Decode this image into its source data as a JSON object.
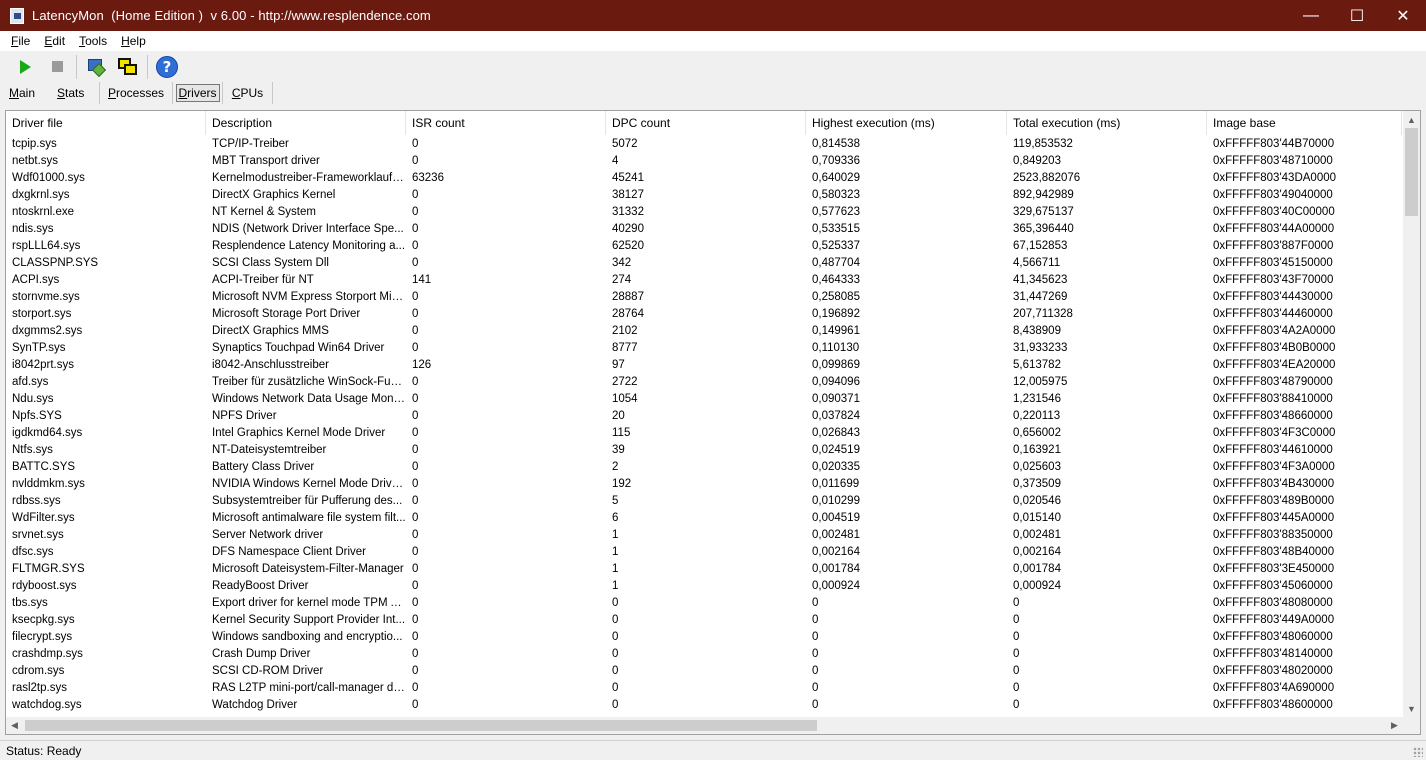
{
  "window": {
    "title": "LatencyMon  (Home Edition )  v 6.00 - http://www.resplendence.com",
    "minimize_glyph": "—",
    "maximize_glyph": "☐",
    "close_glyph": "✕"
  },
  "menu": [
    "File",
    "Edit",
    "Tools",
    "Help"
  ],
  "toolbar": {
    "buttons": [
      {
        "name": "start-icon"
      },
      {
        "name": "stop-icon"
      },
      {
        "name": "tool-icon"
      },
      {
        "name": "windows-icon"
      },
      {
        "name": "help-icon",
        "glyph": "?"
      }
    ]
  },
  "tabs": {
    "main": "Main",
    "stats": "Stats",
    "processes": "Processes",
    "drivers": "Drivers",
    "cpus": "CPUs",
    "selected": "Drivers"
  },
  "table": {
    "columns": [
      "Driver file",
      "Description",
      "ISR count",
      "DPC count",
      "Highest execution (ms)",
      "Total execution (ms)",
      "Image base"
    ],
    "rows": [
      [
        "tcpip.sys",
        "TCP/IP-Treiber",
        "0",
        "5072",
        "0,814538",
        "119,853532",
        "0xFFFFF803'44B70000"
      ],
      [
        "netbt.sys",
        "MBT Transport driver",
        "0",
        "4",
        "0,709336",
        "0,849203",
        "0xFFFFF803'48710000"
      ],
      [
        "Wdf01000.sys",
        "Kernelmodustreiber-Frameworklaufzeit",
        "63236",
        "45241",
        "0,640029",
        "2523,882076",
        "0xFFFFF803'43DA0000"
      ],
      [
        "dxgkrnl.sys",
        "DirectX Graphics Kernel",
        "0",
        "38127",
        "0,580323",
        "892,942989",
        "0xFFFFF803'49040000"
      ],
      [
        "ntoskrnl.exe",
        "NT Kernel & System",
        "0",
        "31332",
        "0,577623",
        "329,675137",
        "0xFFFFF803'40C00000"
      ],
      [
        "ndis.sys",
        "NDIS (Network Driver Interface Spe...",
        "0",
        "40290",
        "0,533515",
        "365,396440",
        "0xFFFFF803'44A00000"
      ],
      [
        "rspLLL64.sys",
        "Resplendence Latency Monitoring a...",
        "0",
        "62520",
        "0,525337",
        "67,152853",
        "0xFFFFF803'887F0000"
      ],
      [
        "CLASSPNP.SYS",
        "SCSI Class System Dll",
        "0",
        "342",
        "0,487704",
        "4,566711",
        "0xFFFFF803'45150000"
      ],
      [
        "ACPI.sys",
        "ACPI-Treiber für NT",
        "141",
        "274",
        "0,464333",
        "41,345623",
        "0xFFFFF803'43F70000"
      ],
      [
        "stornvme.sys",
        "Microsoft NVM Express Storport Mini...",
        "0",
        "28887",
        "0,258085",
        "31,447269",
        "0xFFFFF803'44430000"
      ],
      [
        "storport.sys",
        "Microsoft Storage Port Driver",
        "0",
        "28764",
        "0,196892",
        "207,711328",
        "0xFFFFF803'44460000"
      ],
      [
        "dxgmms2.sys",
        "DirectX Graphics MMS",
        "0",
        "2102",
        "0,149961",
        "8,438909",
        "0xFFFFF803'4A2A0000"
      ],
      [
        "SynTP.sys",
        "Synaptics Touchpad Win64 Driver",
        "0",
        "8777",
        "0,110130",
        "31,933233",
        "0xFFFFF803'4B0B0000"
      ],
      [
        "i8042prt.sys",
        "i8042-Anschlusstreiber",
        "126",
        "97",
        "0,099869",
        "5,613782",
        "0xFFFFF803'4EA20000"
      ],
      [
        "afd.sys",
        "Treiber für zusätzliche WinSock-Fun...",
        "0",
        "2722",
        "0,094096",
        "12,005975",
        "0xFFFFF803'48790000"
      ],
      [
        "Ndu.sys",
        "Windows Network Data Usage Monit...",
        "0",
        "1054",
        "0,090371",
        "1,231546",
        "0xFFFFF803'88410000"
      ],
      [
        "Npfs.SYS",
        "NPFS Driver",
        "0",
        "20",
        "0,037824",
        "0,220113",
        "0xFFFFF803'48660000"
      ],
      [
        "igdkmd64.sys",
        "Intel Graphics Kernel Mode Driver",
        "0",
        "115",
        "0,026843",
        "0,656002",
        "0xFFFFF803'4F3C0000"
      ],
      [
        "Ntfs.sys",
        "NT-Dateisystemtreiber",
        "0",
        "39",
        "0,024519",
        "0,163921",
        "0xFFFFF803'44610000"
      ],
      [
        "BATTC.SYS",
        "Battery Class Driver",
        "0",
        "2",
        "0,020335",
        "0,025603",
        "0xFFFFF803'4F3A0000"
      ],
      [
        "nvlddmkm.sys",
        "NVIDIA Windows Kernel Mode Drive...",
        "0",
        "192",
        "0,011699",
        "0,373509",
        "0xFFFFF803'4B430000"
      ],
      [
        "rdbss.sys",
        "Subsystemtreiber für Pufferung des...",
        "0",
        "5",
        "0,010299",
        "0,020546",
        "0xFFFFF803'489B0000"
      ],
      [
        "WdFilter.sys",
        "Microsoft antimalware file system filt...",
        "0",
        "6",
        "0,004519",
        "0,015140",
        "0xFFFFF803'445A0000"
      ],
      [
        "srvnet.sys",
        "Server Network driver",
        "0",
        "1",
        "0,002481",
        "0,002481",
        "0xFFFFF803'88350000"
      ],
      [
        "dfsc.sys",
        "DFS Namespace Client Driver",
        "0",
        "1",
        "0,002164",
        "0,002164",
        "0xFFFFF803'48B40000"
      ],
      [
        "FLTMGR.SYS",
        "Microsoft Dateisystem-Filter-Manager",
        "0",
        "1",
        "0,001784",
        "0,001784",
        "0xFFFFF803'3E450000"
      ],
      [
        "rdyboost.sys",
        "ReadyBoost Driver",
        "0",
        "1",
        "0,000924",
        "0,000924",
        "0xFFFFF803'45060000"
      ],
      [
        "tbs.sys",
        "Export driver for kernel mode TPM API",
        "0",
        "0",
        "0",
        "0",
        "0xFFFFF803'48080000"
      ],
      [
        "ksecpkg.sys",
        "Kernel Security Support Provider Int...",
        "0",
        "0",
        "0",
        "0",
        "0xFFFFF803'449A0000"
      ],
      [
        "filecrypt.sys",
        "Windows sandboxing and encryptio...",
        "0",
        "0",
        "0",
        "0",
        "0xFFFFF803'48060000"
      ],
      [
        "crashdmp.sys",
        "Crash Dump Driver",
        "0",
        "0",
        "0",
        "0",
        "0xFFFFF803'48140000"
      ],
      [
        "cdrom.sys",
        "SCSI CD-ROM Driver",
        "0",
        "0",
        "0",
        "0",
        "0xFFFFF803'48020000"
      ],
      [
        "rasl2tp.sys",
        "RAS L2TP mini-port/call-manager dri...",
        "0",
        "0",
        "0",
        "0",
        "0xFFFFF803'4A690000"
      ],
      [
        "watchdog.sys",
        "Watchdog Driver",
        "0",
        "0",
        "0",
        "0",
        "0xFFFFF803'48600000"
      ]
    ]
  },
  "scrollbars": {
    "up": "▲",
    "down": "▼",
    "left": "◀",
    "right": "▶"
  },
  "status": "Status: Ready",
  "colors": {
    "titlebar": "#6b1a10",
    "play": "#18a818",
    "help": "#2f6ed6"
  }
}
